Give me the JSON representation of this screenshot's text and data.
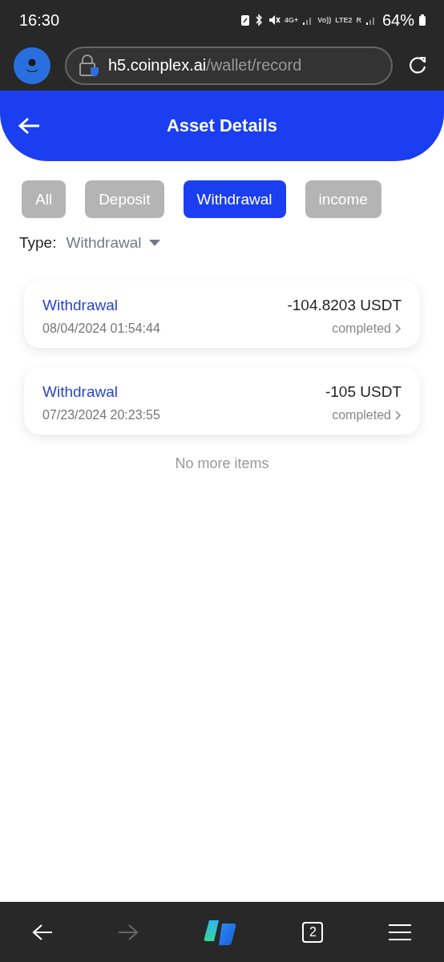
{
  "status_bar": {
    "time": "16:30",
    "network": [
      "4G+",
      "Vo))",
      "LTE2",
      "R"
    ],
    "battery": "64%"
  },
  "browser": {
    "url_host": "h5.coinplex.ai",
    "url_path": "/wallet/record"
  },
  "header": {
    "title": "Asset Details"
  },
  "tabs": [
    {
      "label": "All",
      "selected": false
    },
    {
      "label": "Deposit",
      "selected": false
    },
    {
      "label": "Withdrawal",
      "selected": true
    },
    {
      "label": "income",
      "selected": false
    }
  ],
  "filter": {
    "label": "Type:",
    "value": "Withdrawal"
  },
  "records": [
    {
      "type": "Withdrawal",
      "date": "08/04/2024 01:54:44",
      "amount": "-104.8203 USDT",
      "status": "completed"
    },
    {
      "type": "Withdrawal",
      "date": "07/23/2024 20:23:55",
      "amount": "-105 USDT",
      "status": "completed"
    }
  ],
  "end_note": "No more items",
  "nav": {
    "back_disabled": false,
    "forward_disabled": true,
    "tab_count": "2"
  }
}
